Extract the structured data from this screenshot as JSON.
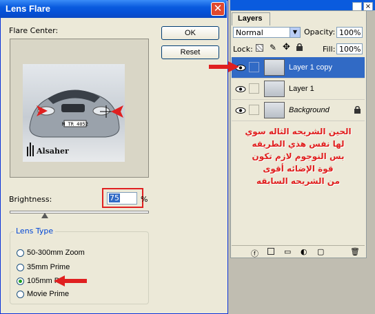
{
  "lens_flare": {
    "title": "Lens Flare",
    "flare_center_label": "Flare Center:",
    "ok_label": "OK",
    "cancel_label": "Reset",
    "brightness_label": "Brightness:",
    "brightness_value": "75",
    "brightness_unit": "%",
    "brightness_level": 0.25,
    "lens_type_label": "Lens Type",
    "lens_types": [
      "50-300mm Zoom",
      "35mm Prime",
      "105mm Prime",
      "Movie Prime"
    ],
    "selected_lens": "105mm Prime",
    "preview": {
      "plate": "M TR 4052",
      "watermark": "Alsaher"
    }
  },
  "layers": {
    "tab_label": "Layers",
    "blend_mode": "Normal",
    "opacity_label": "Opacity:",
    "opacity_value": "100%",
    "lock_label": "Lock:",
    "fill_label": "Fill:",
    "fill_value": "100%",
    "items": [
      {
        "name": "Layer 1 copy",
        "selected": true
      },
      {
        "name": "Layer 1",
        "selected": false
      },
      {
        "name": "Background",
        "selected": false,
        "locked": true
      }
    ],
    "arabic_note": [
      "الحين الشريحه الثاله سوي",
      "لها نفس هذي الطريقه",
      "بس النوجوم لازم تكون",
      "قوة الإضائه أقوى",
      "من الشريحه السابقه"
    ]
  },
  "colors": {
    "accent": "#e02020",
    "selection": "#316ac5",
    "titlebar": "#0a5bde"
  }
}
